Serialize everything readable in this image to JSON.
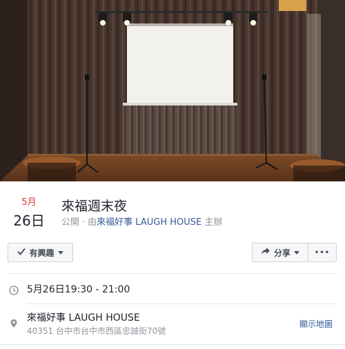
{
  "event": {
    "month": "5月",
    "day": "26日",
    "title": "來福週末夜",
    "privacy": "公開",
    "host_prefix": "由",
    "host": "來福好事 LAUGH HOUSE",
    "host_suffix": "主辦"
  },
  "actions": {
    "interested_label": "有興趣",
    "share_label": "分享",
    "more_label": "•••"
  },
  "details": {
    "time": "5月26日19:30 - 21:00",
    "location_name": "來福好事 LAUGH HOUSE",
    "location_address": "40351 台中市台中市西區忠誠街70號",
    "map_link": "顯示地圖"
  },
  "icons": {
    "check": "check-icon",
    "share": "share-arrow-icon",
    "clock": "clock-icon",
    "pin": "map-pin-icon"
  },
  "colors": {
    "month_red": "#e4312f",
    "link_blue": "#365899",
    "muted_gray": "#90949c"
  }
}
